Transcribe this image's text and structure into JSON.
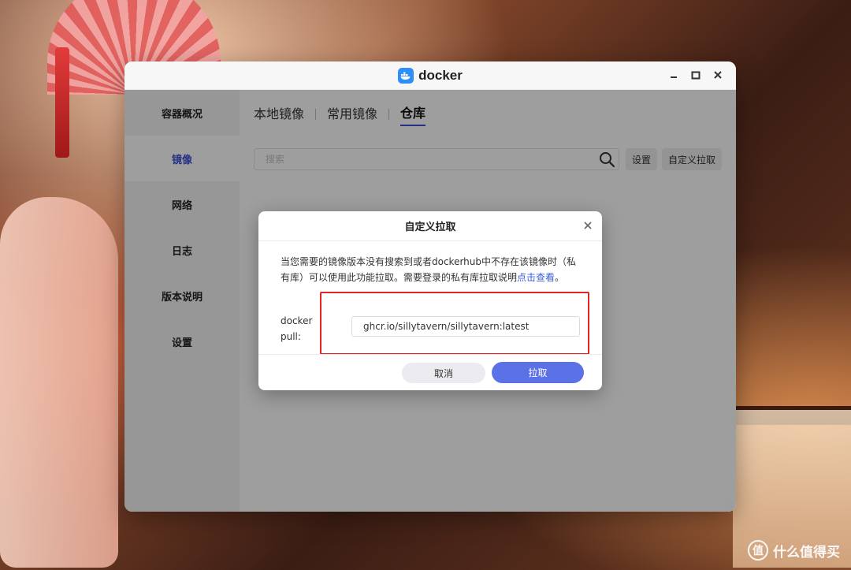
{
  "window": {
    "title": "docker",
    "logo_icon": "docker-whale-icon"
  },
  "sidebar": {
    "items": [
      {
        "label": "容器概况",
        "active": false
      },
      {
        "label": "镜像",
        "active": true
      },
      {
        "label": "网络",
        "active": false
      },
      {
        "label": "日志",
        "active": false
      },
      {
        "label": "版本说明",
        "active": false
      },
      {
        "label": "设置",
        "active": false
      }
    ]
  },
  "tabs": [
    {
      "label": "本地镜像",
      "active": false
    },
    {
      "label": "常用镜像",
      "active": false
    },
    {
      "label": "仓库",
      "active": true
    }
  ],
  "toolbar": {
    "search_placeholder": "搜索",
    "settings_label": "设置",
    "custom_pull_label": "自定义拉取"
  },
  "dialog": {
    "title": "自定义拉取",
    "description": "当您需要的镜像版本没有搜索到或者dockerhub中不存在该镜像时（私有库）可以使用此功能拉取。需要登录的私有库拉取说明",
    "link_text": "点击查看",
    "description_end": "。",
    "pull_label": "docker pull:",
    "pull_value": "ghcr.io/sillytavern/sillytavern:latest",
    "cancel_label": "取消",
    "confirm_label": "拉取"
  },
  "watermark": {
    "text": "什么值得买",
    "logo_glyph": "值"
  },
  "colors": {
    "accent": "#3a4ed8",
    "primary_button": "#5b72e6",
    "highlight_border": "#e52222",
    "link": "#3a5ed8"
  }
}
